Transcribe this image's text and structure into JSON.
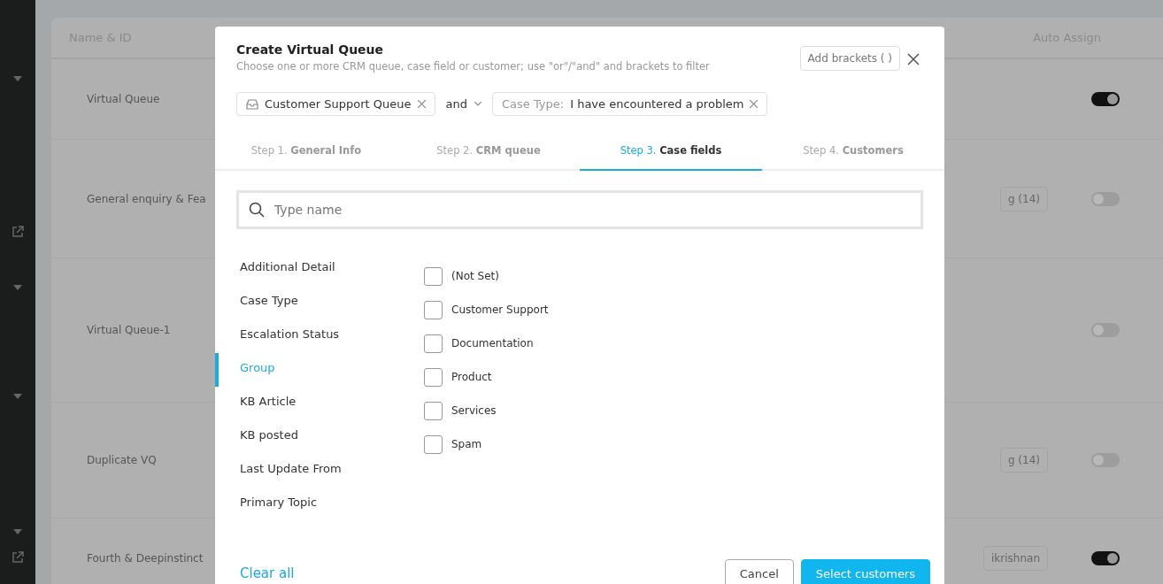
{
  "sidebar": {
    "items": [
      {
        "kind": "caret"
      },
      {
        "kind": "link"
      },
      {
        "kind": "caret"
      },
      {
        "kind": "caret"
      },
      {
        "kind": "caret"
      },
      {
        "kind": "link"
      }
    ]
  },
  "table": {
    "columns": [
      "Name & ID",
      "Auto Assign"
    ],
    "rows": [
      {
        "name": "Virtual Queue",
        "on": true
      },
      {
        "name": "General enquiry & Fea",
        "chip": "g (14)",
        "on": false
      },
      {
        "name": "Virtual Queue-1",
        "on": false
      },
      {
        "name": "Duplicate VQ",
        "chip": "g (14)",
        "on": false
      },
      {
        "name": "Fourth & Deepinstinct",
        "chip": "ikrishnan",
        "on": true
      }
    ]
  },
  "dialog": {
    "title": "Create Virtual Queue",
    "subtitle": "Choose one or more CRM queue, case field or customer; use \"or\"/\"and\" and brackets to filter",
    "add_brackets": "Add brackets ( )",
    "filters": [
      {
        "kind": "queue",
        "value": "Customer Support Queue"
      },
      {
        "kind": "operator",
        "value": "and"
      },
      {
        "kind": "field",
        "label": "Case Type:",
        "value": "I have encountered a problem"
      }
    ],
    "tabs": [
      {
        "step": "Step 1.",
        "label": "General Info",
        "selected": false
      },
      {
        "step": "Step 2.",
        "label": "CRM queue",
        "selected": false
      },
      {
        "step": "Step 3.",
        "label": "Case fields",
        "selected": true
      },
      {
        "step": "Step 4.",
        "label": "Customers",
        "selected": false
      }
    ],
    "search": {
      "placeholder": "Type name"
    },
    "fields": [
      {
        "label": "Additional Detail",
        "selected": false
      },
      {
        "label": "Case Type",
        "selected": false
      },
      {
        "label": "Escalation Status",
        "selected": false
      },
      {
        "label": "Group",
        "selected": true
      },
      {
        "label": "KB Article",
        "selected": false
      },
      {
        "label": "KB posted",
        "selected": false
      },
      {
        "label": "Last Update From",
        "selected": false
      },
      {
        "label": "Primary Topic",
        "selected": false
      }
    ],
    "options": [
      {
        "label": "(Not Set)",
        "checked": false
      },
      {
        "label": "Customer Support",
        "checked": false
      },
      {
        "label": "Documentation",
        "checked": false
      },
      {
        "label": "Product",
        "checked": false
      },
      {
        "label": "Services",
        "checked": false
      },
      {
        "label": "Spam",
        "checked": false
      }
    ],
    "clear_all": "Clear all",
    "cancel": "Cancel",
    "next": "Select customers"
  }
}
